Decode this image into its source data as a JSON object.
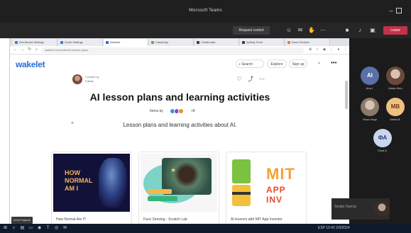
{
  "teams": {
    "window_title": "Microsoft Teams",
    "request_control": "Request control",
    "leave": "Leave",
    "icons": [
      "people-icon",
      "chat-icon",
      "raise-hand-icon",
      "more-icon",
      "camera-icon",
      "mic-icon",
      "share-icon"
    ]
  },
  "browser": {
    "tabs": [
      {
        "label": "Grid Board Settings",
        "color": "#3a7bd5"
      },
      {
        "label": "Zoom Settings",
        "color": "#3a7bd5"
      },
      {
        "label": "Wakelet",
        "color": "#2a6ad7"
      },
      {
        "label": "ClassDojo",
        "color": "#6aa84f"
      },
      {
        "label": "Collaborate",
        "color": "#3a3a3a"
      },
      {
        "label": "Activity Feed",
        "color": "#3a3a3a"
      },
      {
        "label": "Docs Preview",
        "color": "#e67e22"
      }
    ],
    "url": "wakelet.com/wake/AI-lesson-plans"
  },
  "wakelet": {
    "logo": "wakelet",
    "search": "Search",
    "explore": "Explore",
    "signup": "Sign up",
    "author_name": "Created by",
    "follow": "Follow",
    "title": "AI lesson plans and learning activities",
    "byline": "Items by",
    "byline_more": "+8",
    "description": "Lesson plans and learning activities about AI.",
    "cards": [
      {
        "image_text": "HOW\nNORMAL\nAM I",
        "caption": "How Normal Am I?"
      },
      {
        "image_text": "",
        "caption": "Face Sensing - Scratch Lab"
      },
      {
        "image_text": "MIT\nAPP INV",
        "caption": "AI lessons with MIT App Inventor"
      }
    ],
    "presenter_tag": "Irene Fajardo"
  },
  "participants": [
    {
      "initials": "AI",
      "name": "Ana I.",
      "bg": "#5b6fa8",
      "fg": "#ffffff",
      "photo": false
    },
    {
      "initials": "",
      "name": "Maria Soto",
      "bg": "#6b4a3a",
      "fg": "#ffffff",
      "photo": true
    },
    {
      "initials": "",
      "name": "Rosa Vega",
      "bg": "#8a7a6a",
      "fg": "#ffffff",
      "photo": true
    },
    {
      "initials": "MB",
      "name": "Marta B.",
      "bg": "#f0c080",
      "fg": "#6b3a10",
      "photo": false
    },
    {
      "initials": "ФА",
      "name": "Farid A.",
      "bg": "#c8d6ee",
      "fg": "#2a3a6a",
      "photo": false
    }
  ],
  "self_view": {
    "label": "Sergio García"
  },
  "taskbar": {
    "tray": "ESP 10:42  2/3/2024"
  }
}
